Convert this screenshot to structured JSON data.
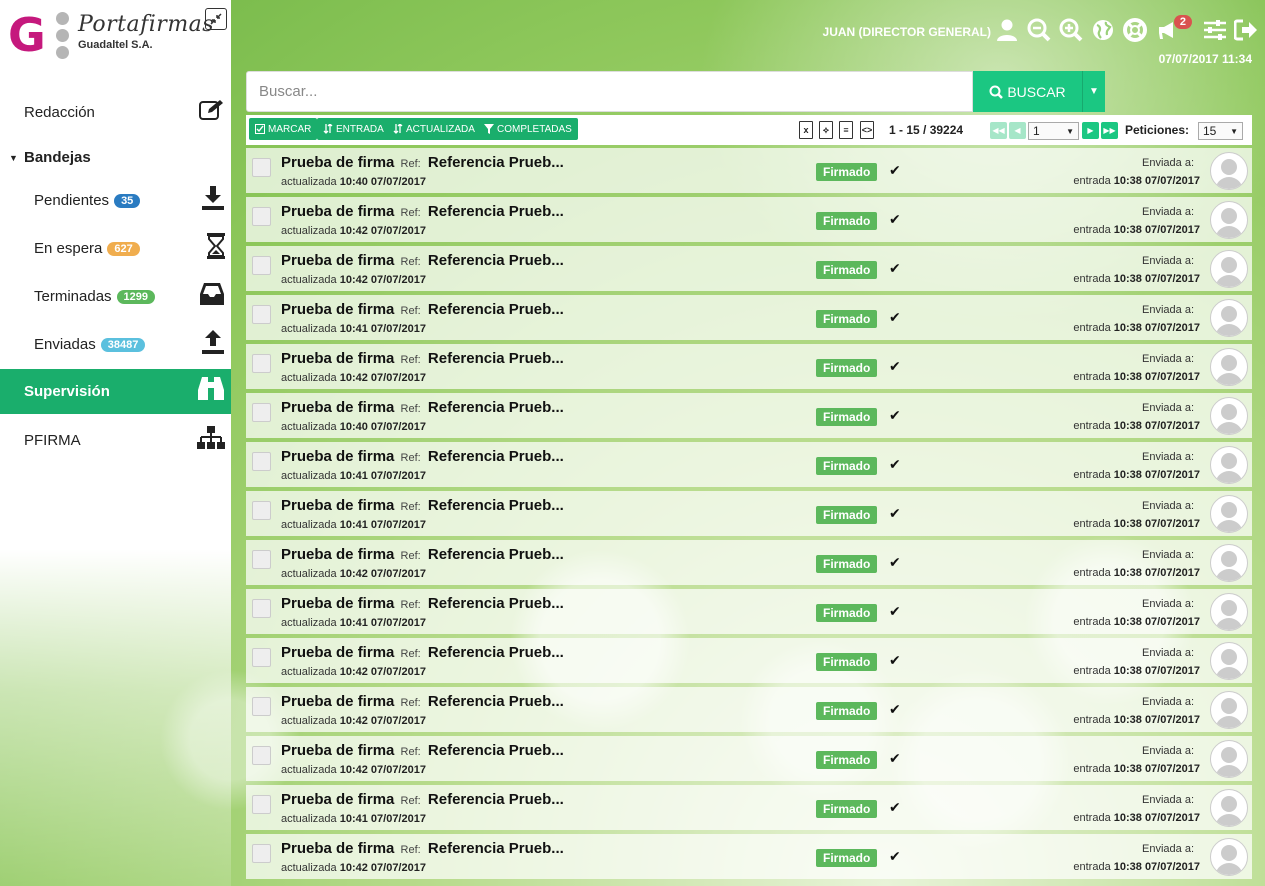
{
  "brand": {
    "name": "Portafirmas",
    "company": "Guadaltel S.A."
  },
  "sidebar": {
    "items": [
      {
        "label": "Redacción",
        "icon": "edit-icon"
      },
      {
        "label": "Bandejas",
        "icon": "caret-down-icon"
      },
      {
        "label": "Pendientes",
        "badge": "35",
        "badge_color": "#2a7bc1",
        "icon": "download-icon"
      },
      {
        "label": "En espera",
        "badge": "627",
        "badge_color": "#f0ad4e",
        "icon": "hourglass-icon"
      },
      {
        "label": "Terminadas",
        "badge": "1299",
        "badge_color": "#5cb85c",
        "icon": "inbox-icon"
      },
      {
        "label": "Enviadas",
        "badge": "38487",
        "badge_color": "#5bc0de",
        "icon": "upload-icon"
      },
      {
        "label": "Supervisión",
        "icon": "binoculars-icon"
      },
      {
        "label": "PFIRMA",
        "icon": "sitemap-icon"
      }
    ]
  },
  "header": {
    "user": "JUAN (DIRECTOR GENERAL)",
    "notifications": "2",
    "datetime": "07/07/2017 11:34"
  },
  "search": {
    "placeholder": "Buscar...",
    "button": "BUSCAR"
  },
  "toolbar": {
    "buttons": [
      "MARCAR",
      "ENTRADA",
      "ACTUALIZADA",
      "COMPLETADAS"
    ],
    "range": "1 - 15 / 39224",
    "page": "1",
    "per_page_label": "Peticiones:",
    "per_page": "15"
  },
  "accent_color": "#1aae6c",
  "rows": [
    {
      "title": "Prueba de firma",
      "ref_label": "Ref:",
      "ref": "Referencia Prueb...",
      "updated_label": "actualizada",
      "updated": "10:40 07/07/2017",
      "status": "Firmado",
      "sent_label": "Enviada a:",
      "entry_label": "entrada",
      "entry": "10:38 07/07/2017"
    },
    {
      "title": "Prueba de firma",
      "ref_label": "Ref:",
      "ref": "Referencia Prueb...",
      "updated_label": "actualizada",
      "updated": "10:42 07/07/2017",
      "status": "Firmado",
      "sent_label": "Enviada a:",
      "entry_label": "entrada",
      "entry": "10:38 07/07/2017"
    },
    {
      "title": "Prueba de firma",
      "ref_label": "Ref:",
      "ref": "Referencia Prueb...",
      "updated_label": "actualizada",
      "updated": "10:42 07/07/2017",
      "status": "Firmado",
      "sent_label": "Enviada a:",
      "entry_label": "entrada",
      "entry": "10:38 07/07/2017"
    },
    {
      "title": "Prueba de firma",
      "ref_label": "Ref:",
      "ref": "Referencia Prueb...",
      "updated_label": "actualizada",
      "updated": "10:41 07/07/2017",
      "status": "Firmado",
      "sent_label": "Enviada a:",
      "entry_label": "entrada",
      "entry": "10:38 07/07/2017"
    },
    {
      "title": "Prueba de firma",
      "ref_label": "Ref:",
      "ref": "Referencia Prueb...",
      "updated_label": "actualizada",
      "updated": "10:42 07/07/2017",
      "status": "Firmado",
      "sent_label": "Enviada a:",
      "entry_label": "entrada",
      "entry": "10:38 07/07/2017"
    },
    {
      "title": "Prueba de firma",
      "ref_label": "Ref:",
      "ref": "Referencia Prueb...",
      "updated_label": "actualizada",
      "updated": "10:40 07/07/2017",
      "status": "Firmado",
      "sent_label": "Enviada a:",
      "entry_label": "entrada",
      "entry": "10:38 07/07/2017"
    },
    {
      "title": "Prueba de firma",
      "ref_label": "Ref:",
      "ref": "Referencia Prueb...",
      "updated_label": "actualizada",
      "updated": "10:41 07/07/2017",
      "status": "Firmado",
      "sent_label": "Enviada a:",
      "entry_label": "entrada",
      "entry": "10:38 07/07/2017"
    },
    {
      "title": "Prueba de firma",
      "ref_label": "Ref:",
      "ref": "Referencia Prueb...",
      "updated_label": "actualizada",
      "updated": "10:41 07/07/2017",
      "status": "Firmado",
      "sent_label": "Enviada a:",
      "entry_label": "entrada",
      "entry": "10:38 07/07/2017"
    },
    {
      "title": "Prueba de firma",
      "ref_label": "Ref:",
      "ref": "Referencia Prueb...",
      "updated_label": "actualizada",
      "updated": "10:42 07/07/2017",
      "status": "Firmado",
      "sent_label": "Enviada a:",
      "entry_label": "entrada",
      "entry": "10:38 07/07/2017"
    },
    {
      "title": "Prueba de firma",
      "ref_label": "Ref:",
      "ref": "Referencia Prueb...",
      "updated_label": "actualizada",
      "updated": "10:41 07/07/2017",
      "status": "Firmado",
      "sent_label": "Enviada a:",
      "entry_label": "entrada",
      "entry": "10:38 07/07/2017"
    },
    {
      "title": "Prueba de firma",
      "ref_label": "Ref:",
      "ref": "Referencia Prueb...",
      "updated_label": "actualizada",
      "updated": "10:42 07/07/2017",
      "status": "Firmado",
      "sent_label": "Enviada a:",
      "entry_label": "entrada",
      "entry": "10:38 07/07/2017"
    },
    {
      "title": "Prueba de firma",
      "ref_label": "Ref:",
      "ref": "Referencia Prueb...",
      "updated_label": "actualizada",
      "updated": "10:42 07/07/2017",
      "status": "Firmado",
      "sent_label": "Enviada a:",
      "entry_label": "entrada",
      "entry": "10:38 07/07/2017"
    },
    {
      "title": "Prueba de firma",
      "ref_label": "Ref:",
      "ref": "Referencia Prueb...",
      "updated_label": "actualizada",
      "updated": "10:42 07/07/2017",
      "status": "Firmado",
      "sent_label": "Enviada a:",
      "entry_label": "entrada",
      "entry": "10:38 07/07/2017"
    },
    {
      "title": "Prueba de firma",
      "ref_label": "Ref:",
      "ref": "Referencia Prueb...",
      "updated_label": "actualizada",
      "updated": "10:41 07/07/2017",
      "status": "Firmado",
      "sent_label": "Enviada a:",
      "entry_label": "entrada",
      "entry": "10:38 07/07/2017"
    },
    {
      "title": "Prueba de firma",
      "ref_label": "Ref:",
      "ref": "Referencia Prueb...",
      "updated_label": "actualizada",
      "updated": "10:42 07/07/2017",
      "status": "Firmado",
      "sent_label": "Enviada a:",
      "entry_label": "entrada",
      "entry": "10:38 07/07/2017"
    }
  ]
}
